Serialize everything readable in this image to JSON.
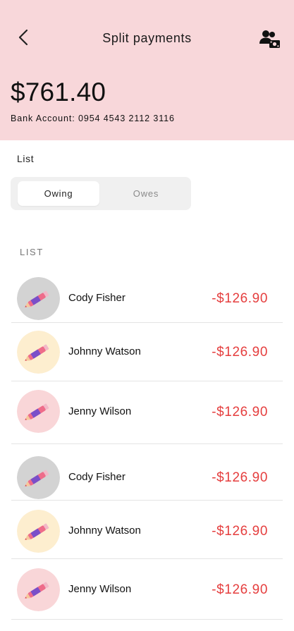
{
  "header": {
    "title": "Split payments",
    "balance": "$761.40",
    "bank_account": "Bank Account: 0954 4543 2112 3116",
    "back_icon": "chevron-left-icon",
    "action_icon": "group-money-icon"
  },
  "tabs_section": {
    "heading": "List",
    "tabs": [
      {
        "label": "Owing",
        "selected": true
      },
      {
        "label": "Owes",
        "selected": false
      }
    ]
  },
  "list": {
    "label": "LIST",
    "items": [
      {
        "name": "Cody Fisher",
        "amount": "-$126.90",
        "avatar_bg": "#d3d3d3"
      },
      {
        "name": "Johnny Watson",
        "amount": "-$126.90",
        "avatar_bg": "#fdeecf"
      },
      {
        "name": "Jenny Wilson",
        "amount": "-$126.90",
        "avatar_bg": "#f9d6d8"
      },
      {
        "name": "Cody Fisher",
        "amount": "-$126.90",
        "avatar_bg": "#d3d3d3"
      },
      {
        "name": "Johnny Watson",
        "amount": "-$126.90",
        "avatar_bg": "#fdeecf"
      },
      {
        "name": "Jenny Wilson",
        "amount": "-$126.90",
        "avatar_bg": "#f9d6d8"
      }
    ]
  },
  "colors": {
    "header_bg": "#f8d7da",
    "amount_negative": "#e53e3e",
    "segment_bg": "#f0f0f0"
  }
}
